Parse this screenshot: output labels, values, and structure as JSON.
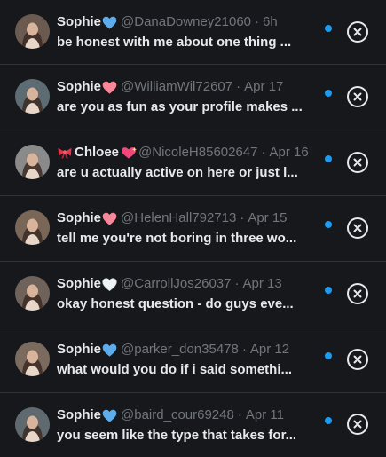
{
  "colors": {
    "background": "#16181c",
    "divider": "#2f3336",
    "text_primary": "#e7e9ea",
    "text_secondary": "#71767b",
    "unread": "#1d9bf0"
  },
  "icons": {
    "close": "close-circle-icon",
    "unread": "unread-dot-icon",
    "blue_heart": "blue-heart-icon",
    "pink_heart": "pink-heart-icon",
    "white_heart": "white-heart-icon",
    "bow": "ribbon-bow-icon",
    "hearts_sparkle": "sparkling-hearts-icon"
  },
  "conversations": [
    {
      "name": "Sophie",
      "name_emoji": "blue-heart-icon",
      "handle": "@DanaDowney21060",
      "separator": "·",
      "time": "6h",
      "preview": "be honest with me about one thing ...",
      "avatar_bg": "#6b5a4f"
    },
    {
      "name": "Sophie",
      "name_emoji": "pink-heart-icon",
      "handle": "@WilliamWil72607",
      "separator": "·",
      "time": "Apr 17",
      "preview": "are you as fun as your profile makes ...",
      "avatar_bg": "#5d6b73"
    },
    {
      "name": "Chloee",
      "name_prefix_emoji": "ribbon-bow-icon",
      "name_emoji": "sparkling-hearts-icon",
      "handle": "@NicoleH85602647",
      "separator": "·",
      "time": "Apr 16",
      "preview": "are u actually active on here or just l...",
      "avatar_bg": "#8a8a8a"
    },
    {
      "name": "Sophie",
      "name_emoji": "pink-heart-icon",
      "handle": "@HelenHall792713",
      "separator": "·",
      "time": "Apr 15",
      "preview": "tell me you're not boring in three wo...",
      "avatar_bg": "#7a6656"
    },
    {
      "name": "Sophie",
      "name_emoji": "white-heart-icon",
      "handle": "@CarrollJos26037",
      "separator": "·",
      "time": "Apr 13",
      "preview": "okay honest question - do guys eve...",
      "avatar_bg": "#6f625a"
    },
    {
      "name": "Sophie",
      "name_emoji": "blue-heart-icon",
      "handle": "@parker_don35478",
      "separator": "·",
      "time": "Apr 12",
      "preview": "what would you do if i said somethi...",
      "avatar_bg": "#7b6a5e"
    },
    {
      "name": "Sophie",
      "name_emoji": "blue-heart-icon",
      "handle": "@baird_cour69248",
      "separator": "·",
      "time": "Apr 11",
      "preview": "you seem like the type that takes for...",
      "avatar_bg": "#5f6a70"
    }
  ]
}
